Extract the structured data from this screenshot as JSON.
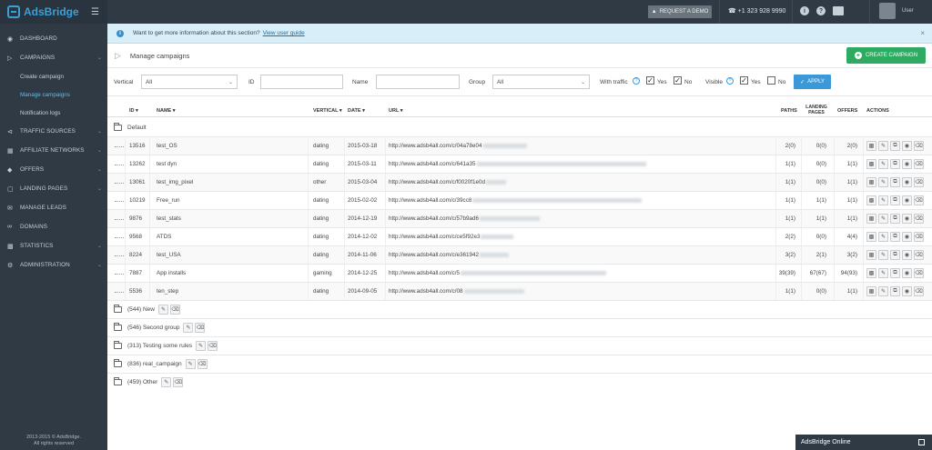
{
  "app": {
    "logo": "AdsBridge",
    "request_demo": "REQUEST A DEMO",
    "phone": "+1 323 928 9990",
    "user": "User"
  },
  "sidebar": {
    "items": [
      {
        "label": "DASHBOARD",
        "icon": "dashboard-icon"
      },
      {
        "label": "CAMPAIGNS",
        "icon": "megaphone-icon"
      },
      {
        "label": "TRAFFIC SOURCES",
        "icon": "share-icon"
      },
      {
        "label": "AFFILIATE NETWORKS",
        "icon": "network-icon"
      },
      {
        "label": "OFFERS",
        "icon": "tag-icon"
      },
      {
        "label": "LANDING PAGES",
        "icon": "page-icon"
      },
      {
        "label": "MANAGE LEADS",
        "icon": "leads-icon"
      },
      {
        "label": "DOMAINS",
        "icon": "link-icon"
      },
      {
        "label": "STATISTICS",
        "icon": "chart-icon"
      },
      {
        "label": "ADMINISTRATION",
        "icon": "gear-icon"
      }
    ],
    "sub": [
      "Create campaign",
      "Manage campaigns",
      "Notification logs"
    ],
    "copyright_1": "2013-2015 © AdsBridge.",
    "copyright_2": "All rights reserved"
  },
  "info": {
    "text": "Want to get more information about this section?",
    "link": "View user guide"
  },
  "header": {
    "title": "Manage campaigns",
    "create": "CREATE CAMPAIGN"
  },
  "filters": {
    "vertical_label": "Vertical",
    "vertical_value": "All",
    "id_label": "ID",
    "name_label": "Name",
    "group_label": "Group",
    "group_value": "All",
    "traffic_label": "With traffic",
    "visible_label": "Visible",
    "yes": "Yes",
    "no": "No",
    "apply": "APPLY"
  },
  "table": {
    "columns": {
      "id": "ID",
      "name": "NAME",
      "vertical": "VERTICAL",
      "date": "DATE",
      "url": "URL",
      "paths": "PATHS",
      "landing_1": "LANDING",
      "landing_2": "PAGES",
      "offers": "OFFERS",
      "actions": "ACTIONS"
    },
    "default_group": "Default",
    "rows": [
      {
        "id": "13516",
        "name": "test_OS",
        "vertical": "dating",
        "date": "2015-03-18",
        "url": "http://www.adsb4all.com/c/04a78e04",
        "paths": "2(0)",
        "landing": "0(0)",
        "offers": "2(0)"
      },
      {
        "id": "13262",
        "name": "test dyn",
        "vertical": "dating",
        "date": "2015-03-11",
        "url": "http://www.adsb4all.com/c/641a35",
        "paths": "1(1)",
        "landing": "0(0)",
        "offers": "1(1)"
      },
      {
        "id": "13061",
        "name": "test_img_pixel",
        "vertical": "other",
        "date": "2015-03-04",
        "url": "http://www.adsb4all.com/c/f0020f1e0d",
        "paths": "1(1)",
        "landing": "0(0)",
        "offers": "1(1)"
      },
      {
        "id": "10219",
        "name": "Free_run",
        "vertical": "dating",
        "date": "2015-02-02",
        "url": "http://www.adsb4all.com/c/39cc8",
        "paths": "1(1)",
        "landing": "1(1)",
        "offers": "1(1)"
      },
      {
        "id": "9876",
        "name": "test_stats",
        "vertical": "dating",
        "date": "2014-12-19",
        "url": "http://www.adsb4all.com/c/57b9ad6",
        "paths": "1(1)",
        "landing": "1(1)",
        "offers": "1(1)"
      },
      {
        "id": "9568",
        "name": "ATDS",
        "vertical": "dating",
        "date": "2014-12-02",
        "url": "http://www.adsb4all.com/c/ce5f92e3",
        "paths": "2(2)",
        "landing": "0(0)",
        "offers": "4(4)"
      },
      {
        "id": "8224",
        "name": "test_USA",
        "vertical": "dating",
        "date": "2014-11-06",
        "url": "http://www.adsb4all.com/c/e361942",
        "paths": "3(2)",
        "landing": "2(1)",
        "offers": "3(2)"
      },
      {
        "id": "7887",
        "name": "App installs",
        "vertical": "gaming",
        "date": "2014-12-25",
        "url": "http://www.adsb4all.com/c/5",
        "paths": "39(39)",
        "landing": "67(67)",
        "offers": "94(93)"
      },
      {
        "id": "5536",
        "name": "ten_step",
        "vertical": "dating",
        "date": "2014-09-05",
        "url": "http://www.adsb4all.com/c/08",
        "paths": "1(1)",
        "landing": "0(0)",
        "offers": "1(1)"
      }
    ],
    "groups": [
      "(544) New",
      "(546) Second group",
      "(313) Testing some rules",
      "(836) real_campaign",
      "(459) Other"
    ]
  },
  "chat": {
    "label": "AdsBridge Online"
  }
}
